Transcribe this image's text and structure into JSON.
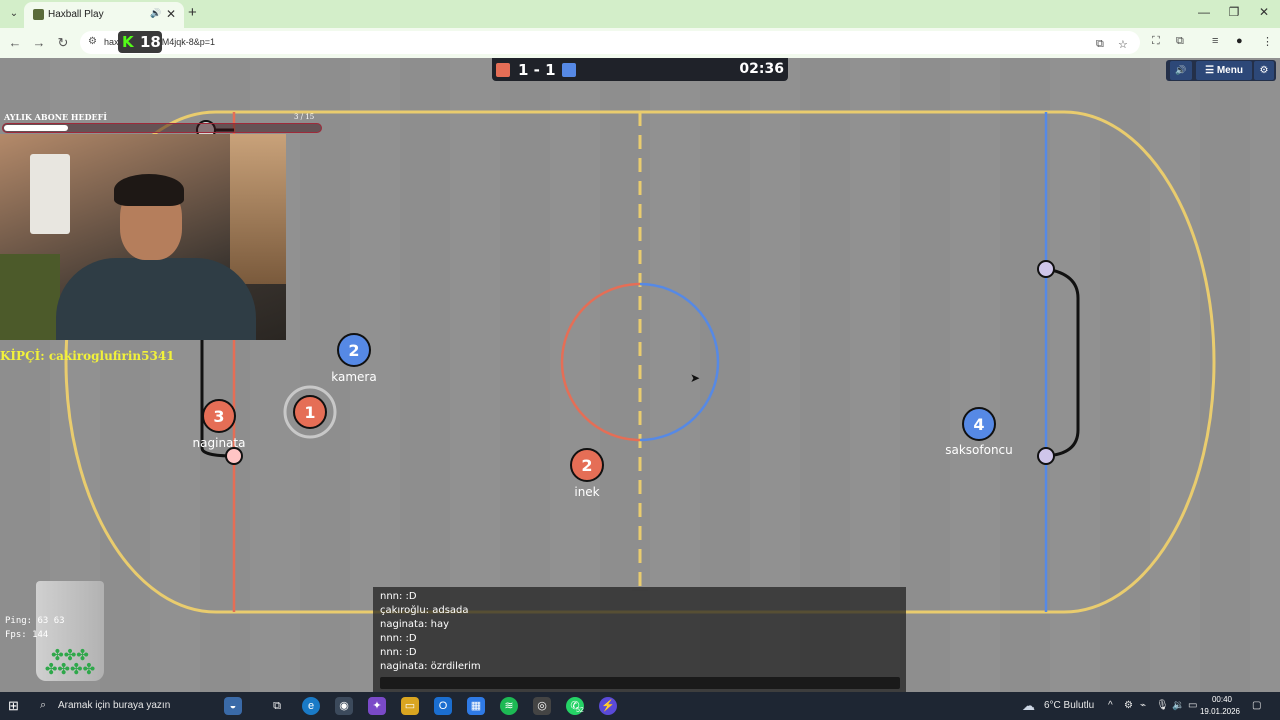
{
  "browser": {
    "tab_title": "Haxball Play",
    "url": "hax          ay?c=ifpGM4jqk-8&p=1",
    "kick_viewers": "18",
    "kick_letter": "K"
  },
  "game": {
    "score": "1 - 1",
    "timer": "02:36",
    "red_color": "#e56e56",
    "blue_color": "#5689e5",
    "menu_label": "Menu"
  },
  "overlay": {
    "goal_title": "AYLIK ABONE HEDEFİ",
    "goal_count": "3  / 15",
    "goal_progress": 0.2,
    "sponsor": "KİPÇİ: cakiroglufirin5341",
    "ping": "Ping: 63 63",
    "fps": "Fps: 144"
  },
  "players": [
    {
      "number": "2",
      "name": "kamera",
      "team": "blue"
    },
    {
      "number": "3",
      "name": "naginata",
      "team": "red"
    },
    {
      "number": "1",
      "name": "",
      "team": "red"
    },
    {
      "number": "2",
      "name": "inek",
      "team": "red"
    },
    {
      "number": "4",
      "name": "saksofoncu",
      "team": "blue"
    }
  ],
  "chat": {
    "messages": [
      "nnn: :D",
      "çakıroğlu: adsada",
      "naginata: hay",
      "nnn: :D",
      "nnn: :D",
      "naginata: özrdilerim"
    ]
  },
  "taskbar": {
    "search_placeholder": "Aramak için buraya yazın",
    "weather": "6°C  Bulutlu",
    "time": "00:40",
    "date": "19.01.2026",
    "whatsapp_badge": "52"
  }
}
